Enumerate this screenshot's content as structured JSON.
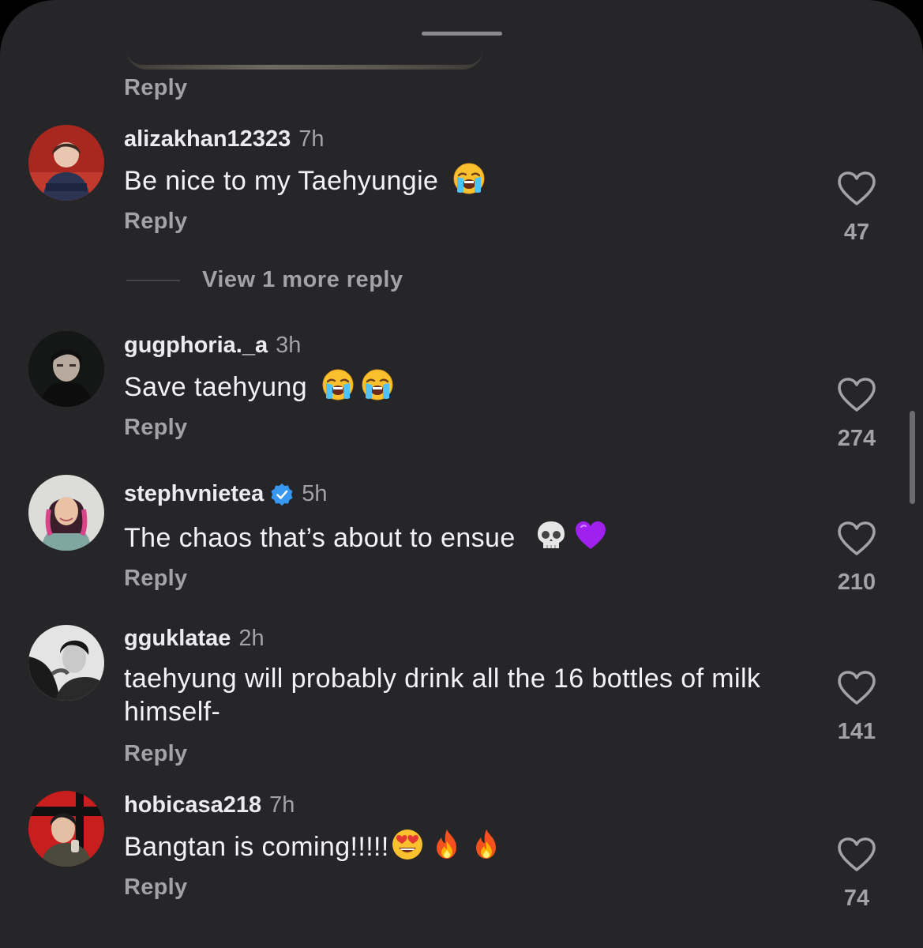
{
  "previous": {
    "reply_label": "Reply"
  },
  "comments": [
    {
      "username": "alizakhan12323",
      "time": "7h",
      "text": "Be nice to my Taehyungie",
      "emojis": [
        "loudly-crying-face"
      ],
      "reply_label": "Reply",
      "likes": "47",
      "view_more": "View 1 more reply"
    },
    {
      "username": "gugphoria._a",
      "time": "3h",
      "text": "Save taehyung",
      "emojis": [
        "loudly-crying-face",
        "loudly-crying-face"
      ],
      "reply_label": "Reply",
      "likes": "274"
    },
    {
      "username": "stephvnietea",
      "verified": true,
      "time": "5h",
      "text": "The chaos that’s about to ensue",
      "emojis": [
        "skull",
        "purple-heart"
      ],
      "reply_label": "Reply",
      "likes": "210"
    },
    {
      "username": "gguklatae",
      "time": "2h",
      "text": "taehyung will probably drink all the 16 bottles of milk himself-",
      "emojis": [],
      "reply_label": "Reply",
      "likes": "141"
    },
    {
      "username": "hobicasa218",
      "time": "7h",
      "text": "Bangtan is coming!!!!!",
      "emojis": [
        "heart-eyes",
        "fire",
        "fire"
      ],
      "reply_label": "Reply",
      "likes": "74"
    }
  ],
  "colors": {
    "background": "#262628",
    "primary_text": "#f3f3f5",
    "secondary_text": "#a2a2a7",
    "verified_blue": "#3897f0"
  }
}
